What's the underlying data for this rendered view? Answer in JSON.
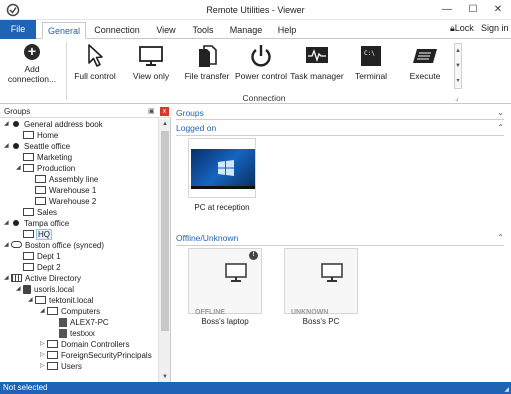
{
  "window": {
    "title": "Remote Utilities - Viewer",
    "minimize": "—",
    "maximize": "☐",
    "close": "✕"
  },
  "tabs": {
    "file": "File",
    "items": [
      "General",
      "Connection",
      "View",
      "Tools",
      "Manage",
      "Help"
    ],
    "active": "General"
  },
  "header_right": {
    "lock": "Lock",
    "signin": "Sign in"
  },
  "ribbon": {
    "add_connection": "Add connection...",
    "buttons": [
      {
        "label": "Full control",
        "icon": "cursor-icon"
      },
      {
        "label": "View only",
        "icon": "monitor-icon"
      },
      {
        "label": "File transfer",
        "icon": "file-transfer-icon"
      },
      {
        "label": "Power control",
        "icon": "power-icon"
      },
      {
        "label": "Task manager",
        "icon": "task-manager-icon"
      },
      {
        "label": "Terminal",
        "icon": "terminal-icon"
      },
      {
        "label": "Execute",
        "icon": "execute-icon"
      }
    ],
    "group_label": "Connection",
    "terminal_glyph": "C:\\"
  },
  "groups_panel": {
    "title": "Groups",
    "pin": "▣",
    "close": "x",
    "tree": [
      {
        "label": "General address book",
        "type": "address-book",
        "depth": 0,
        "expand": "◢"
      },
      {
        "label": "Home",
        "type": "folder",
        "depth": 1,
        "expand": ""
      },
      {
        "label": "Seattle office",
        "type": "address-book",
        "depth": 0,
        "expand": "◢"
      },
      {
        "label": "Marketing",
        "type": "folder",
        "depth": 1,
        "expand": ""
      },
      {
        "label": "Production",
        "type": "folder",
        "depth": 1,
        "expand": "◢"
      },
      {
        "label": "Assembly line",
        "type": "folder",
        "depth": 2,
        "expand": ""
      },
      {
        "label": "Warehouse 1",
        "type": "folder",
        "depth": 2,
        "expand": ""
      },
      {
        "label": "Warehouse 2",
        "type": "folder",
        "depth": 2,
        "expand": ""
      },
      {
        "label": "Sales",
        "type": "folder",
        "depth": 1,
        "expand": ""
      },
      {
        "label": "Tampa office",
        "type": "address-book",
        "depth": 0,
        "expand": "◢"
      },
      {
        "label": "HQ",
        "type": "folder",
        "depth": 1,
        "expand": "",
        "highlight": true
      },
      {
        "label": "Boston office (synced)",
        "type": "cloud",
        "depth": 0,
        "expand": "◢"
      },
      {
        "label": "Dept 1",
        "type": "folder",
        "depth": 1,
        "expand": ""
      },
      {
        "label": "Dept 2",
        "type": "folder",
        "depth": 1,
        "expand": ""
      },
      {
        "label": "Active Directory",
        "type": "ad",
        "depth": 0,
        "expand": "◢"
      },
      {
        "label": "usoris.local",
        "type": "domain",
        "depth": 1,
        "expand": "◢"
      },
      {
        "label": "tektonit.local",
        "type": "folder",
        "depth": 2,
        "expand": "◢"
      },
      {
        "label": "Computers",
        "type": "folder",
        "depth": 3,
        "expand": "◢"
      },
      {
        "label": "ALEX7-PC",
        "type": "pc",
        "depth": 4,
        "expand": ""
      },
      {
        "label": "testxxx",
        "type": "pc",
        "depth": 4,
        "expand": ""
      },
      {
        "label": "Domain Controllers",
        "type": "folder",
        "depth": 3,
        "expand": "▷"
      },
      {
        "label": "ForeignSecurityPrincipals",
        "type": "folder",
        "depth": 3,
        "expand": "▷"
      },
      {
        "label": "Users",
        "type": "folder",
        "depth": 3,
        "expand": "▷"
      }
    ]
  },
  "main": {
    "groups_header": "Groups",
    "logged_on_header": "Logged on",
    "offline_header": "Offline/Unknown",
    "logged_on": [
      {
        "caption": "PC at reception"
      }
    ],
    "offline": [
      {
        "caption": "Boss's laptop",
        "status": "OFFLINE"
      },
      {
        "caption": "Boss's PC",
        "status": "UNKNOWN"
      }
    ]
  },
  "statusbar": {
    "text": "Not selected",
    "grip": "◢"
  },
  "colors": {
    "accent": "#1e63b5",
    "close_red": "#d9382b"
  }
}
